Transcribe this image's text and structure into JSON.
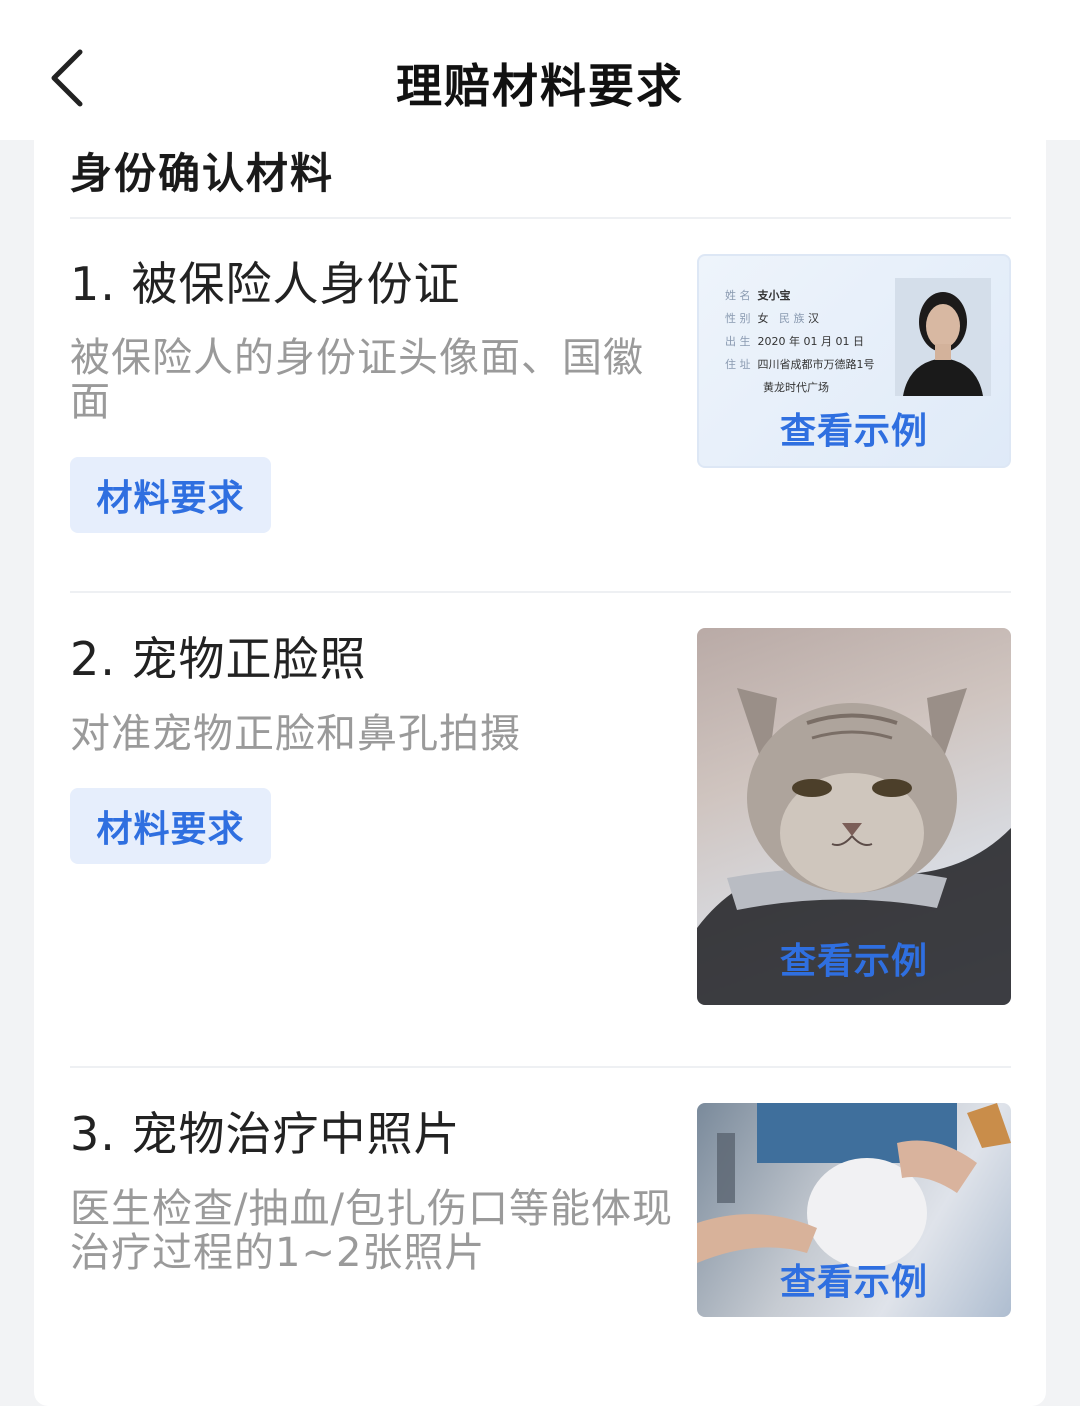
{
  "header": {
    "title": "理赔材料要求",
    "back_icon": "chevron-left-icon"
  },
  "section": {
    "title": "身份确认材料"
  },
  "items": [
    {
      "title": "1. 被保险人身份证",
      "desc": "被保险人的身份证头像面、国徽面",
      "button": "材料要求",
      "example_label": "查看示例",
      "id_card": {
        "name": "支小宝",
        "sex": "女",
        "ethnic": "汉",
        "birth": "2020 年 01 月 01 日",
        "address_1": "四川省成都市万德路1号",
        "address_2": "黄龙时代广场"
      }
    },
    {
      "title": "2. 宠物正脸照",
      "desc": "对准宠物正脸和鼻孔拍摄",
      "button": "材料要求",
      "example_label": "查看示例"
    },
    {
      "title": "3. 宠物治疗中照片",
      "desc": "医生检查/抽血/包扎伤口等能体现治疗过程的1~2张照片",
      "example_label": "查看示例"
    }
  ],
  "colors": {
    "accent": "#2f6fe0",
    "button_bg": "#e6eefc",
    "page_bg": "#f2f3f5"
  }
}
